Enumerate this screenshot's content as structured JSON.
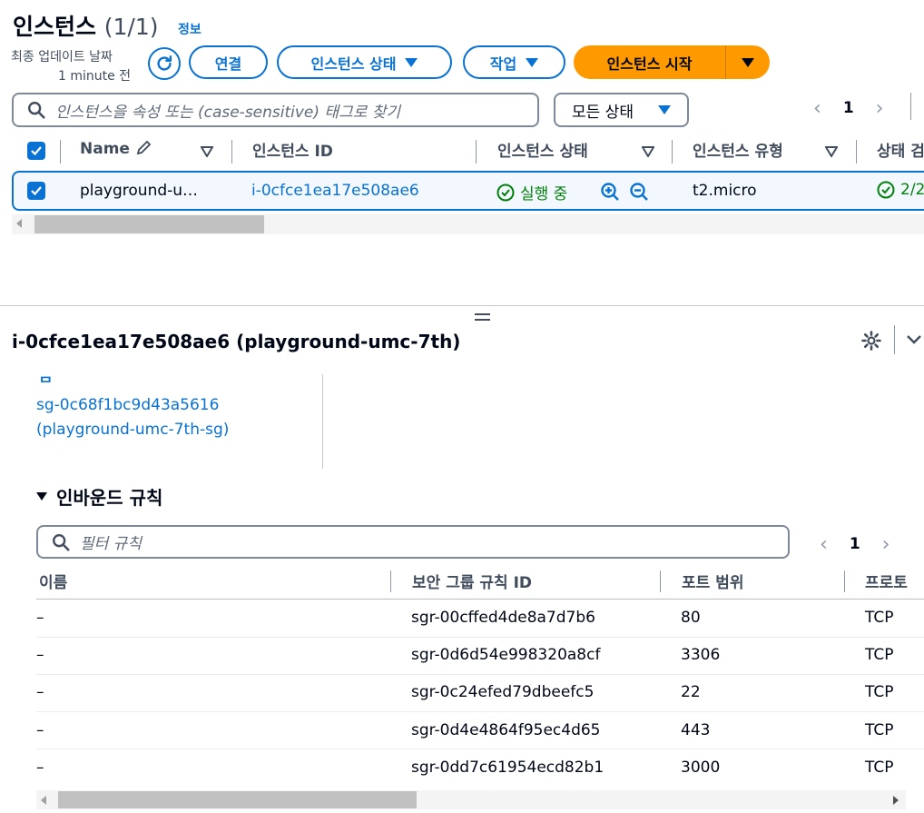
{
  "header": {
    "title": "인스턴스",
    "count": "(1/1)",
    "info_link": "정보",
    "last_update_label": "최종 업데이트 날짜",
    "last_update_value": "1 minute 전"
  },
  "toolbar": {
    "connect": "연결",
    "instance_state": "인스턴스 상태",
    "actions": "작업",
    "launch": "인스턴스 시작"
  },
  "filter": {
    "placeholder": "인스턴스을 속성 또는 (case-sensitive) 태그로 찾기",
    "state_select": "모든 상태"
  },
  "pagination": {
    "page": "1"
  },
  "table": {
    "columns": [
      "Name",
      "인스턴스 ID",
      "인스턴스 상태",
      "인스턴스 유형",
      "상태 검"
    ],
    "rows": [
      {
        "name": "playground-u…",
        "instance_id": "i-0cfce1ea17e508ae6",
        "state": "실행 중",
        "type": "t2.micro",
        "check": "2/2"
      }
    ]
  },
  "detail": {
    "title": "i-0cfce1ea17e508ae6 (playground-umc-7th)",
    "sg_label_partial": "ᄆ",
    "sg_id": "sg-0c68f1bc9d43a5616",
    "sg_name": "(playground-umc-7th-sg)",
    "inbound_title": "인바운드 규칙",
    "rules_search_placeholder": "필터 규칙",
    "rules_page": "1",
    "rules_columns": [
      "이름",
      "보안 그룹 규칙 ID",
      "포트 범위",
      "프로토"
    ],
    "rules": [
      {
        "name": "–",
        "id": "sgr-00cffed4de8a7d7b6",
        "port": "80",
        "protocol": "TCP"
      },
      {
        "name": "–",
        "id": "sgr-0d6d54e998320a8cf",
        "port": "3306",
        "protocol": "TCP"
      },
      {
        "name": "–",
        "id": "sgr-0c24efed79dbeefc5",
        "port": "22",
        "protocol": "TCP"
      },
      {
        "name": "–",
        "id": "sgr-0d4e4864f95ec4d65",
        "port": "443",
        "protocol": "TCP"
      },
      {
        "name": "–",
        "id": "sgr-0dd7c61954ecd82b1",
        "port": "3000",
        "protocol": "TCP"
      }
    ]
  },
  "colors": {
    "accent": "#0972d3",
    "primary": "#ff9900",
    "success": "#037f0c"
  }
}
